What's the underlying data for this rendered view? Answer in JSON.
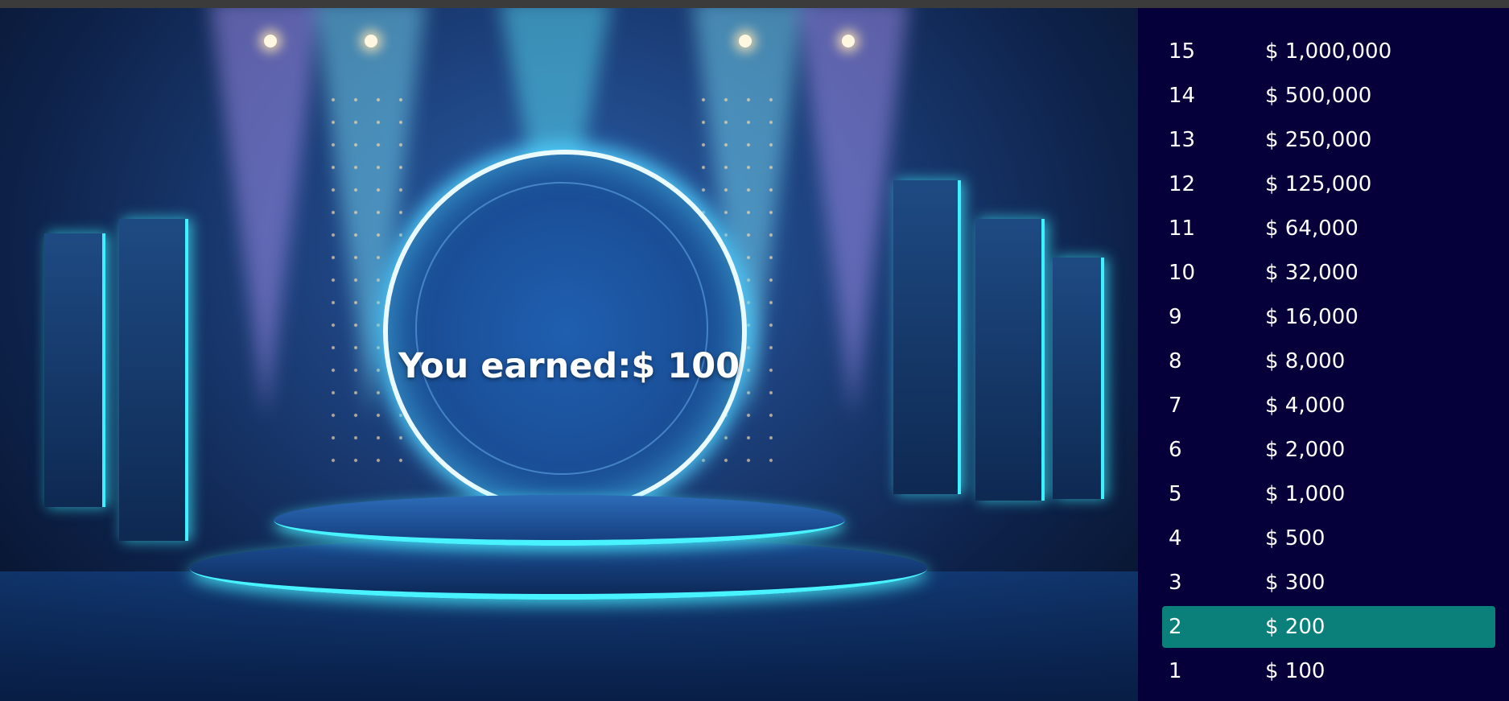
{
  "result": {
    "prefix": "You earned: ",
    "amount": "$ 100"
  },
  "pyramid": [
    {
      "level": "15",
      "amount": "$ 1,000,000"
    },
    {
      "level": "14",
      "amount": "$ 500,000"
    },
    {
      "level": "13",
      "amount": "$ 250,000"
    },
    {
      "level": "12",
      "amount": "$ 125,000"
    },
    {
      "level": "11",
      "amount": "$ 64,000"
    },
    {
      "level": "10",
      "amount": "$ 32,000"
    },
    {
      "level": "9",
      "amount": "$ 16,000"
    },
    {
      "level": "8",
      "amount": "$ 8,000"
    },
    {
      "level": "7",
      "amount": "$ 4,000"
    },
    {
      "level": "6",
      "amount": "$ 2,000"
    },
    {
      "level": "5",
      "amount": "$ 1,000"
    },
    {
      "level": "4",
      "amount": "$ 500"
    },
    {
      "level": "3",
      "amount": "$ 300"
    },
    {
      "level": "2",
      "amount": "$ 200"
    },
    {
      "level": "1",
      "amount": "$ 100"
    }
  ],
  "highlighted_level": "2",
  "colors": {
    "sidebar_bg": "#05003a",
    "highlight": "#0b7f7a",
    "neon": "#48f3ff"
  }
}
